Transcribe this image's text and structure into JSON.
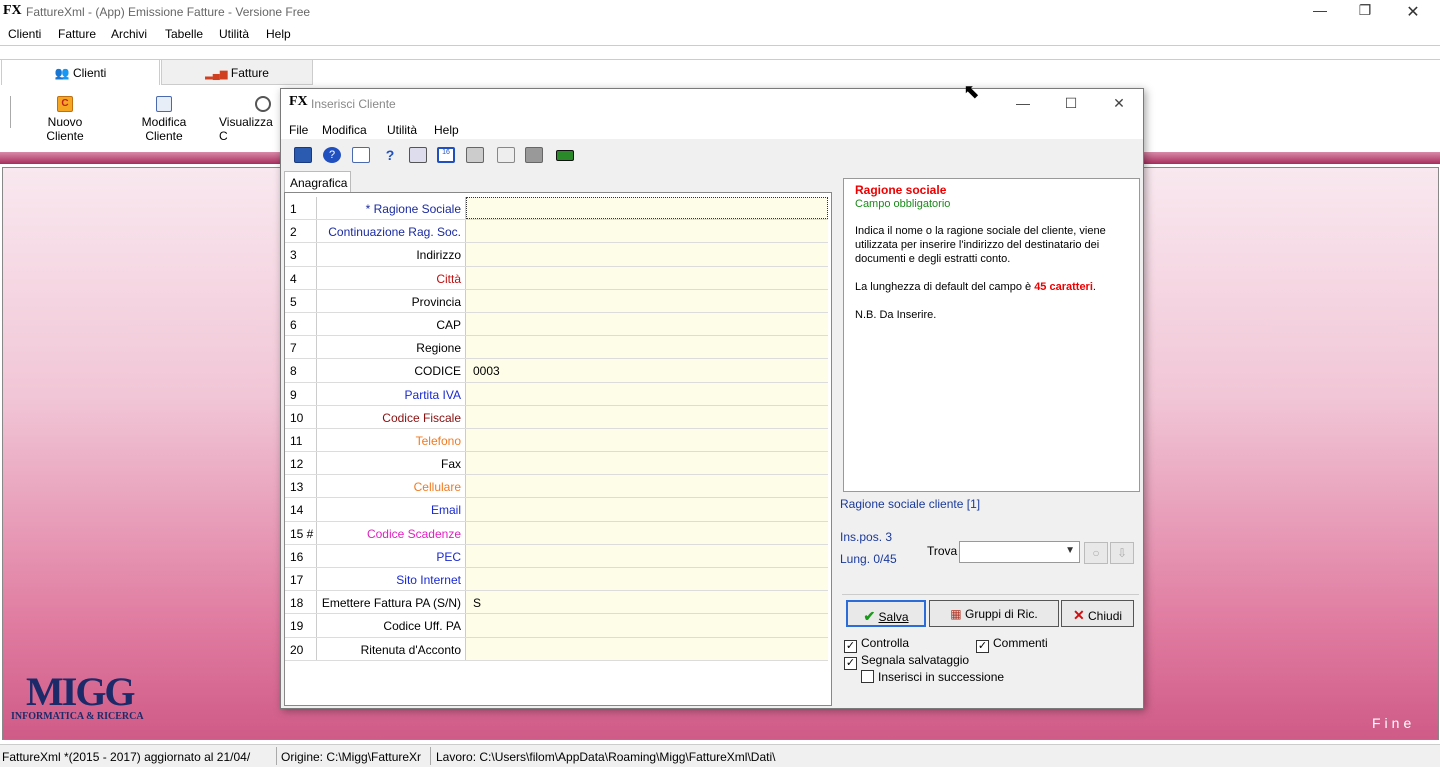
{
  "window": {
    "title": "FattureXml  - (App) Emissione Fatture - Versione Free",
    "icon_text": "FX"
  },
  "menu": [
    "Clienti",
    "Fatture",
    "Archivi",
    "Tabelle",
    "Utilità",
    "Help"
  ],
  "tabs": {
    "clienti": "Clienti",
    "fatture": "Fatture"
  },
  "ribbon": {
    "nuovo": "Nuovo Cliente",
    "modifica": "Modifica Cliente",
    "visualizza": "Visualizza C"
  },
  "dialog": {
    "title": "Inserisci Cliente",
    "menu": [
      "File",
      "Modifica",
      "Utilità",
      "Help"
    ],
    "tab": "Anagrafica",
    "rows": [
      {
        "n": "1",
        "label": "* Ragione Sociale",
        "value": "",
        "color": "#1a2aa0"
      },
      {
        "n": "2",
        "label": "Continuazione Rag. Soc.",
        "value": "",
        "color": "#1a2aa0"
      },
      {
        "n": "3",
        "label": "Indirizzo",
        "value": "",
        "color": "#000000"
      },
      {
        "n": "4",
        "label": "Città",
        "value": "",
        "color": "#c01010"
      },
      {
        "n": "5",
        "label": "Provincia",
        "value": "",
        "color": "#000000"
      },
      {
        "n": "6",
        "label": "CAP",
        "value": "",
        "color": "#000000"
      },
      {
        "n": "7",
        "label": "Regione",
        "value": "",
        "color": "#000000"
      },
      {
        "n": "8",
        "label": "CODICE",
        "value": "0003",
        "color": "#000000"
      },
      {
        "n": "9",
        "label": "Partita IVA",
        "value": "",
        "color": "#1a2ad0"
      },
      {
        "n": "10",
        "label": "Codice Fiscale",
        "value": "",
        "color": "#8a1010"
      },
      {
        "n": "11",
        "label": "Telefono",
        "value": "",
        "color": "#f07a20"
      },
      {
        "n": "12",
        "label": "Fax",
        "value": "",
        "color": "#000000"
      },
      {
        "n": "13",
        "label": "Cellulare",
        "value": "",
        "color": "#f07a20"
      },
      {
        "n": "14",
        "label": "Email",
        "value": "",
        "color": "#1a2ad0"
      },
      {
        "n": "15 #",
        "label": "Codice Scadenze",
        "value": "",
        "color": "#e020c0"
      },
      {
        "n": "16",
        "label": "PEC",
        "value": "",
        "color": "#1a2ad0"
      },
      {
        "n": "17",
        "label": "Sito Internet",
        "value": "",
        "color": "#1a2ad0"
      },
      {
        "n": "18",
        "label": "Emettere Fattura PA (S/N)",
        "value": "S",
        "color": "#000000"
      },
      {
        "n": "19",
        "label": "Codice Uff. PA",
        "value": "",
        "color": "#000000"
      },
      {
        "n": "20",
        "label": "Ritenuta d'Acconto",
        "value": "",
        "color": "#000000"
      }
    ],
    "help": {
      "title": "Ragione sociale",
      "subtitle": "Campo obbligatorio",
      "p1": "Indica il nome o la ragione sociale del cliente, viene utilizzata per inserire l'indirizzo del destinatario dei documenti e degli estratti conto.",
      "p2_pre": "La lunghezza di default del campo è ",
      "p2_bold": "45 caratteri",
      "p2_post": ".",
      "p3": "N.B. Da Inserire."
    },
    "field_status": "Ragione sociale cliente [1]",
    "inspos": "Ins.pos. 3",
    "lung": "Lung. 0/45",
    "trova_label": "Trova",
    "trova_value": "",
    "buttons": {
      "salva": "Salva",
      "gruppi": "Gruppi di Ric.",
      "chiudi": "Chiudi"
    },
    "checks": {
      "controlla": {
        "label": "Controlla",
        "checked": true
      },
      "commenti": {
        "label": "Commenti",
        "checked": true
      },
      "segnala": {
        "label": "Segnala salvataggio",
        "checked": true
      },
      "successione": {
        "label": "Inserisci in successione",
        "checked": false
      }
    }
  },
  "logo": {
    "text": "MIGG",
    "sub": "INFORMATICA & RICERCA"
  },
  "fine": "Fine",
  "status": {
    "s1": "FattureXml *(2015 - 2017)  aggiornato al 21/04/",
    "s2": "Origine: C:\\Migg\\FattureXr",
    "s3": "Lavoro: C:\\Users\\filom\\AppData\\Roaming\\Migg\\FattureXml\\Dati\\"
  }
}
